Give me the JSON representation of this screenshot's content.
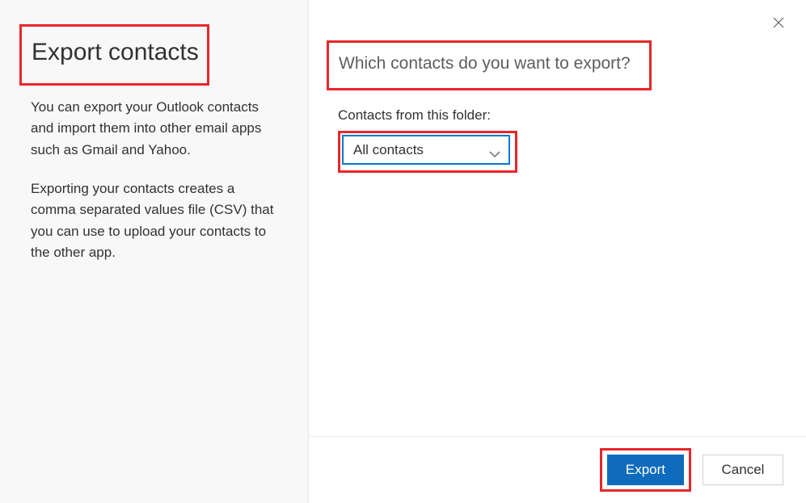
{
  "left": {
    "title": "Export contacts",
    "desc1": "You can export your Outlook contacts and import them into other email apps such as Gmail and Yahoo.",
    "desc2": "Exporting your contacts creates a comma separated values file (CSV) that you can use to upload your contacts to the other app."
  },
  "right": {
    "question": "Which contacts do you want to export?",
    "folder_label": "Contacts from this folder:",
    "dropdown_value": "All contacts"
  },
  "footer": {
    "export_label": "Export",
    "cancel_label": "Cancel"
  }
}
